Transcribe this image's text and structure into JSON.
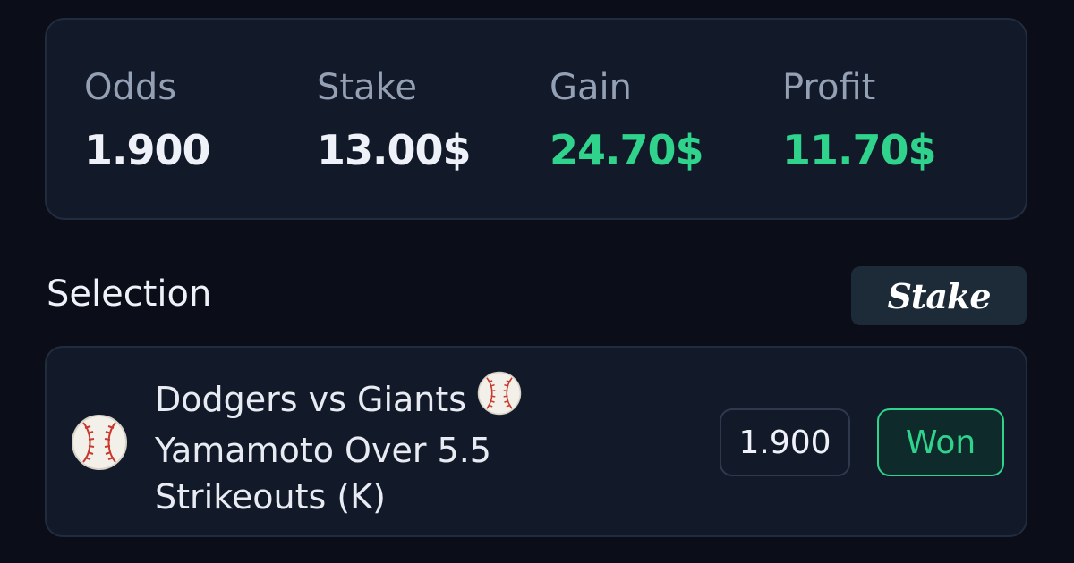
{
  "summary": {
    "odds": {
      "label": "Odds",
      "value": "1.900"
    },
    "stake": {
      "label": "Stake",
      "value": "13.00$"
    },
    "gain": {
      "label": "Gain",
      "value": "24.70$"
    },
    "profit": {
      "label": "Profit",
      "value": "11.70$"
    }
  },
  "selection_section": {
    "title": "Selection",
    "brand": "Stake"
  },
  "selection": {
    "line1": "Dodgers vs Giants",
    "line2": "Yamamoto Over 5.5",
    "line3": "Strikeouts (K)",
    "odds": "1.900",
    "status": "Won",
    "icon": "baseball-icon"
  },
  "colors": {
    "background": "#0b0e18",
    "card": "#121a2a",
    "accent_green": "#2fd38c",
    "label_gray": "#94a0b4"
  }
}
